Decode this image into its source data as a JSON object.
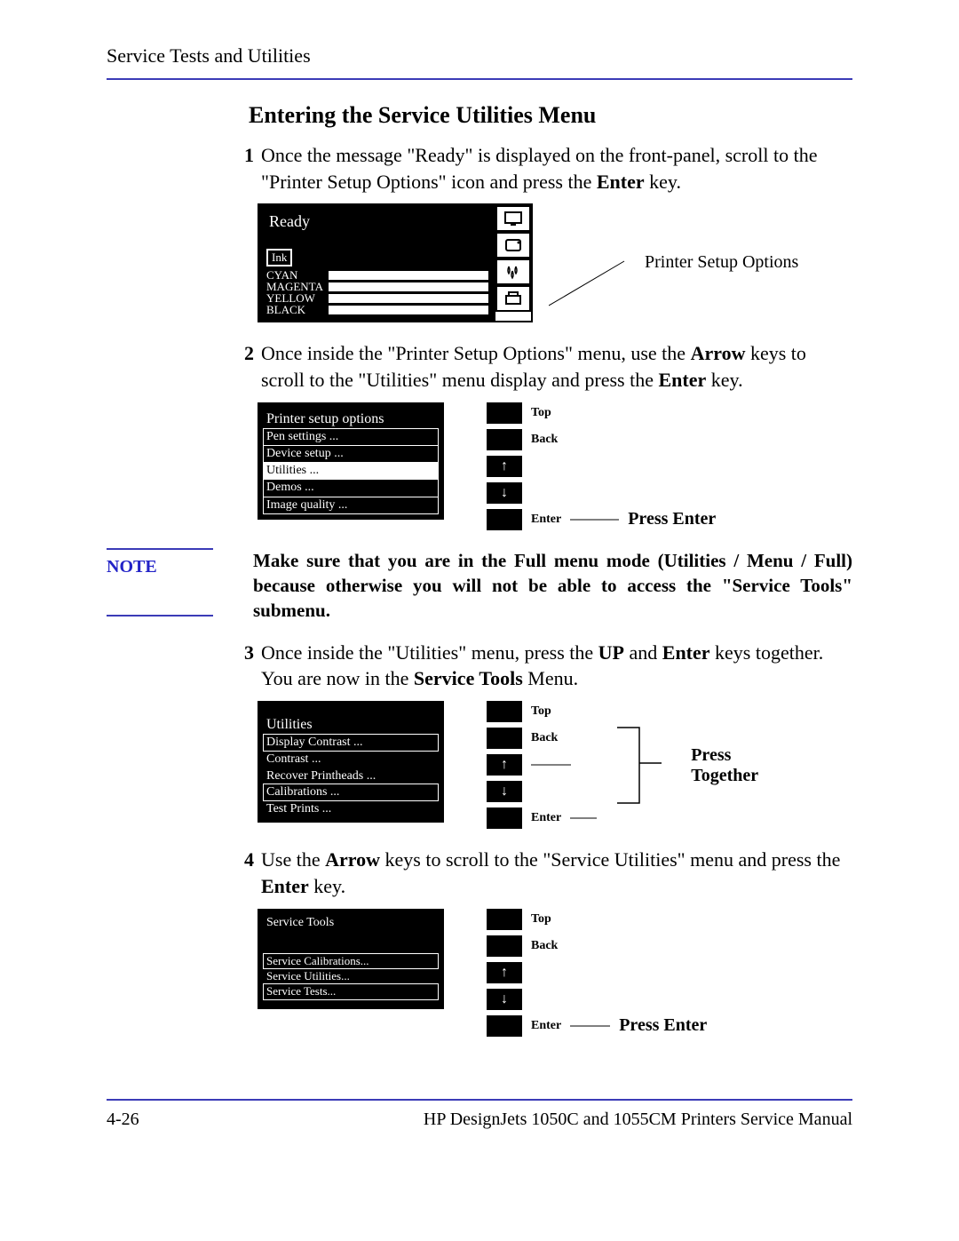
{
  "header": {
    "left": "Service Tests and Utilities"
  },
  "section_title": "Entering the Service Utilities Menu",
  "step1": {
    "num": "1",
    "text_pre": "Once the message \"Ready\" is displayed on the front-panel, scroll to the \"Printer Setup Options\" icon and press the ",
    "enter": "Enter",
    "text_post": " key."
  },
  "lcd1": {
    "title": "Ready",
    "ink_label": "Ink",
    "rows": [
      "CYAN",
      "MAGENTA",
      "YELLOW",
      "BLACK"
    ],
    "annot": "Printer Setup Options"
  },
  "step2": {
    "num": "2",
    "p1": "Once inside the \"Printer Setup Options\" menu, use the ",
    "arrow": "Arrow",
    "p2": " keys to scroll to the \"Utilities\" menu display and press the ",
    "enter": "Enter",
    "p3": " key."
  },
  "lcd2": {
    "title": "Printer setup options",
    "items": [
      "Pen settings ...",
      "Device setup ...",
      "Utilities ...",
      "Demos ...",
      "Image quality ..."
    ],
    "highlight_index": 2
  },
  "btns": {
    "top": "Top",
    "back": "Back",
    "up": "↑",
    "down": "↓",
    "enter": "Enter"
  },
  "annot2": "Press Enter",
  "note": {
    "label": "NOTE",
    "body": "Make sure that you are in the Full menu mode (Utilities / Menu / Full) because otherwise you will not be able to access the \"Service Tools\" submenu."
  },
  "step3": {
    "num": "3",
    "p1": "Once inside the \"Utilities\" menu, press the ",
    "up": "UP",
    "p2": " and ",
    "enter": "Enter",
    "p3": " keys together. You are now in the ",
    "svc": "Service Tools",
    "p4": " Menu."
  },
  "lcd3": {
    "title": "Utilities",
    "items": [
      "Display Contrast ...",
      "Contrast ...",
      "Recover Printheads ...",
      "Calibrations ...",
      "Test Prints ..."
    ]
  },
  "annot3a": "Press",
  "annot3b": "Together",
  "step4": {
    "num": "4",
    "p1": "Use the ",
    "arrow": "Arrow",
    "p2": " keys to scroll to the \"Service Utilities\" menu and press the ",
    "enter": "Enter",
    "p3": " key."
  },
  "lcd4": {
    "title": "Service Tools",
    "items": [
      "Service Calibrations...",
      "Service Utilities...",
      "Service Tests..."
    ]
  },
  "annot4": "Press Enter",
  "footer": {
    "page": "4-26",
    "right": "HP DesignJets 1050C and 1055CM Printers Service Manual"
  }
}
